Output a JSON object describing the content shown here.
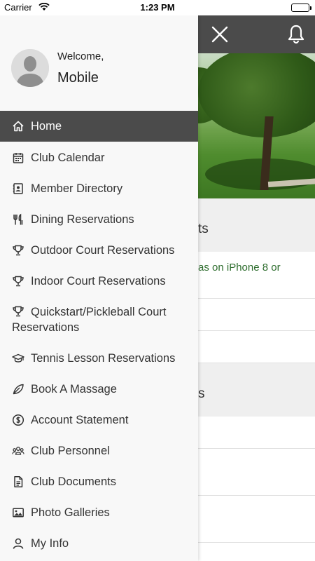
{
  "status_bar": {
    "carrier": "Carrier",
    "time": "1:23 PM"
  },
  "profile": {
    "welcome": "Welcome,",
    "name": "Mobile"
  },
  "menu": [
    {
      "label": "Home",
      "icon": "home-icon",
      "active": true
    },
    {
      "label": "Club Calendar",
      "icon": "calendar-icon"
    },
    {
      "label": "Member Directory",
      "icon": "contact-book-icon"
    },
    {
      "label": "Dining Reservations",
      "icon": "fork-knife-icon"
    },
    {
      "label": "Outdoor Court Reservations",
      "icon": "trophy-icon"
    },
    {
      "label": "Indoor Court Reservations",
      "icon": "trophy-icon"
    },
    {
      "label": "Quickstart/Pickleball Court Reservations",
      "icon": "trophy-icon"
    },
    {
      "label": "Tennis Lesson Reservations",
      "icon": "graduation-cap-icon"
    },
    {
      "label": "Book A Massage",
      "icon": "leaf-icon"
    },
    {
      "label": "Account Statement",
      "icon": "dollar-circle-icon"
    },
    {
      "label": "Club Personnel",
      "icon": "group-icon"
    },
    {
      "label": "Club Documents",
      "icon": "document-icon"
    },
    {
      "label": "Photo Galleries",
      "icon": "image-icon"
    },
    {
      "label": "My Info",
      "icon": "user-icon"
    }
  ],
  "background": {
    "section1_title_fragment": "ts",
    "row1_text_fragment": "as on iPhone 8 or",
    "section2_title_fragment": "s"
  },
  "colors": {
    "header": "#4b4b4b",
    "drawer": "#f8f8f8",
    "link_green": "#2e6d2e"
  }
}
